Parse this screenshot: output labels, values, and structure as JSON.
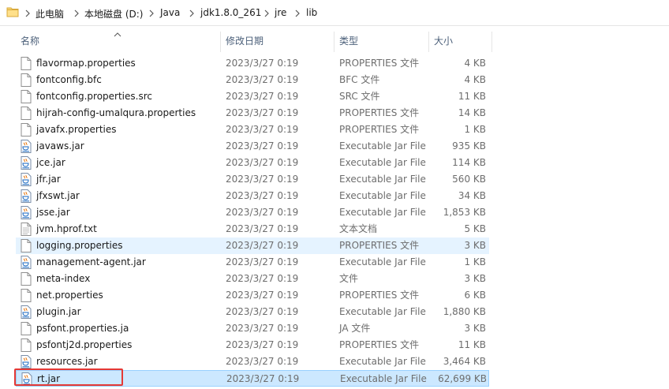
{
  "breadcrumb": [
    "此电脑",
    "本地磁盘 (D:)",
    "Java",
    "jdk1.8.0_261",
    "jre",
    "lib"
  ],
  "columns": {
    "name": "名称",
    "date": "修改日期",
    "type": "类型",
    "size": "大小"
  },
  "files": [
    {
      "name": "flavormap.properties",
      "date": "2023/3/27 0:19",
      "type": "PROPERTIES 文件",
      "size": "4 KB",
      "icon": "document-icon"
    },
    {
      "name": "fontconfig.bfc",
      "date": "2023/3/27 0:19",
      "type": "BFC 文件",
      "size": "4 KB",
      "icon": "document-icon"
    },
    {
      "name": "fontconfig.properties.src",
      "date": "2023/3/27 0:19",
      "type": "SRC 文件",
      "size": "11 KB",
      "icon": "document-icon"
    },
    {
      "name": "hijrah-config-umalqura.properties",
      "date": "2023/3/27 0:19",
      "type": "PROPERTIES 文件",
      "size": "14 KB",
      "icon": "document-icon"
    },
    {
      "name": "javafx.properties",
      "date": "2023/3/27 0:19",
      "type": "PROPERTIES 文件",
      "size": "1 KB",
      "icon": "document-icon"
    },
    {
      "name": "javaws.jar",
      "date": "2023/3/27 0:19",
      "type": "Executable Jar File",
      "size": "935 KB",
      "icon": "jar-icon"
    },
    {
      "name": "jce.jar",
      "date": "2023/3/27 0:19",
      "type": "Executable Jar File",
      "size": "114 KB",
      "icon": "jar-icon"
    },
    {
      "name": "jfr.jar",
      "date": "2023/3/27 0:19",
      "type": "Executable Jar File",
      "size": "560 KB",
      "icon": "jar-icon"
    },
    {
      "name": "jfxswt.jar",
      "date": "2023/3/27 0:19",
      "type": "Executable Jar File",
      "size": "34 KB",
      "icon": "jar-icon"
    },
    {
      "name": "jsse.jar",
      "date": "2023/3/27 0:19",
      "type": "Executable Jar File",
      "size": "1,853 KB",
      "icon": "jar-icon"
    },
    {
      "name": "jvm.hprof.txt",
      "date": "2023/3/27 0:19",
      "type": "文本文档",
      "size": "5 KB",
      "icon": "text-document-icon"
    },
    {
      "name": "logging.properties",
      "date": "2023/3/27 0:19",
      "type": "PROPERTIES 文件",
      "size": "3 KB",
      "icon": "document-icon",
      "state": "hover"
    },
    {
      "name": "management-agent.jar",
      "date": "2023/3/27 0:19",
      "type": "Executable Jar File",
      "size": "1 KB",
      "icon": "jar-icon"
    },
    {
      "name": "meta-index",
      "date": "2023/3/27 0:19",
      "type": "文件",
      "size": "3 KB",
      "icon": "document-icon"
    },
    {
      "name": "net.properties",
      "date": "2023/3/27 0:19",
      "type": "PROPERTIES 文件",
      "size": "6 KB",
      "icon": "document-icon"
    },
    {
      "name": "plugin.jar",
      "date": "2023/3/27 0:19",
      "type": "Executable Jar File",
      "size": "1,880 KB",
      "icon": "jar-icon"
    },
    {
      "name": "psfont.properties.ja",
      "date": "2023/3/27 0:19",
      "type": "JA 文件",
      "size": "3 KB",
      "icon": "document-icon"
    },
    {
      "name": "psfontj2d.properties",
      "date": "2023/3/27 0:19",
      "type": "PROPERTIES 文件",
      "size": "11 KB",
      "icon": "document-icon"
    },
    {
      "name": "resources.jar",
      "date": "2023/3/27 0:19",
      "type": "Executable Jar File",
      "size": "3,464 KB",
      "icon": "jar-icon"
    },
    {
      "name": "rt.jar",
      "date": "2023/3/27 0:19",
      "type": "Executable Jar File",
      "size": "62,699 KB",
      "icon": "jar-icon",
      "state": "selected"
    }
  ],
  "colors": {
    "selected_bg": "#cce8ff",
    "selected_border": "#99d1ff",
    "hover_bg": "#e5f3ff",
    "annotation": "#e53935",
    "header_text": "#4c607a"
  }
}
